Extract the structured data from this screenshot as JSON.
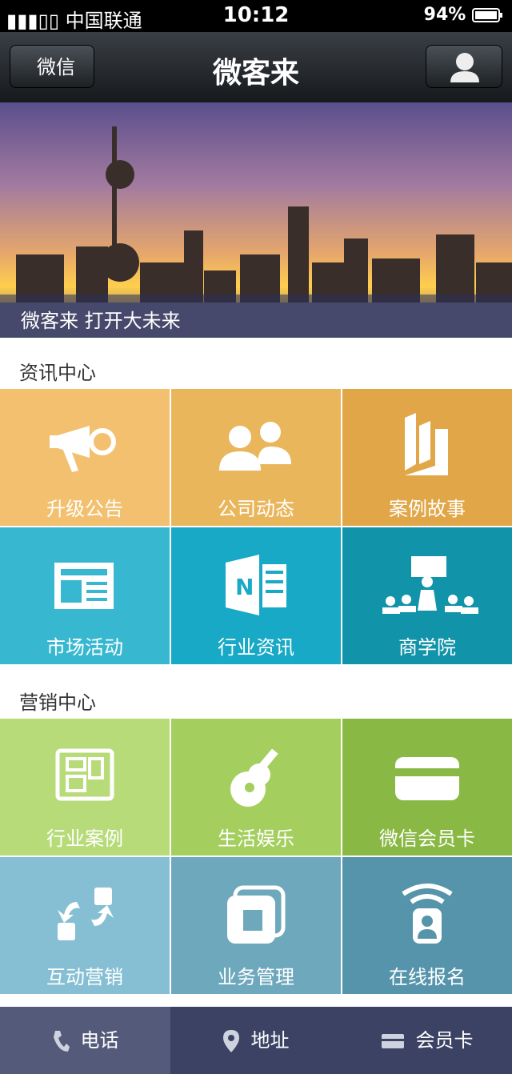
{
  "status_bar": {
    "carrier": "▮▮▮▯▯ 中国联通",
    "time": "10:12",
    "battery": "94%"
  },
  "nav": {
    "back_label": "微信",
    "title": "微客来"
  },
  "banner": {
    "caption": "微客来  打开大未来"
  },
  "news_section": {
    "title": "资讯中心",
    "tiles": [
      {
        "label": "升级公告",
        "icon": "megaphone-icon",
        "color": "#f2c06f"
      },
      {
        "label": "公司动态",
        "icon": "people-icon",
        "color": "#eab65b"
      },
      {
        "label": "案例故事",
        "icon": "book-icon",
        "color": "#e1a648"
      },
      {
        "label": "市场活动",
        "icon": "newspaper-icon",
        "color": "#38b8d0"
      },
      {
        "label": "行业资讯",
        "icon": "note-icon",
        "color": "#17a9c5"
      },
      {
        "label": "商学院",
        "icon": "classroom-icon",
        "color": "#1193a9"
      }
    ]
  },
  "marketing_section": {
    "title": "营销中心",
    "tiles": [
      {
        "label": "行业案例",
        "icon": "case-icon",
        "color": "#b8db7a"
      },
      {
        "label": "生活娱乐",
        "icon": "guitar-icon",
        "color": "#a4ce5e"
      },
      {
        "label": "微信会员卡",
        "icon": "card-icon",
        "color": "#8ab844"
      },
      {
        "label": "互动营销",
        "icon": "interaction-icon",
        "color": "#86bfd3"
      },
      {
        "label": "业务管理",
        "icon": "folders-icon",
        "color": "#6ea8bd"
      },
      {
        "label": "在线报名",
        "icon": "signup-icon",
        "color": "#5694ab"
      }
    ]
  },
  "tabbar": {
    "phone": "电话",
    "address": "地址",
    "member": "会员卡"
  }
}
